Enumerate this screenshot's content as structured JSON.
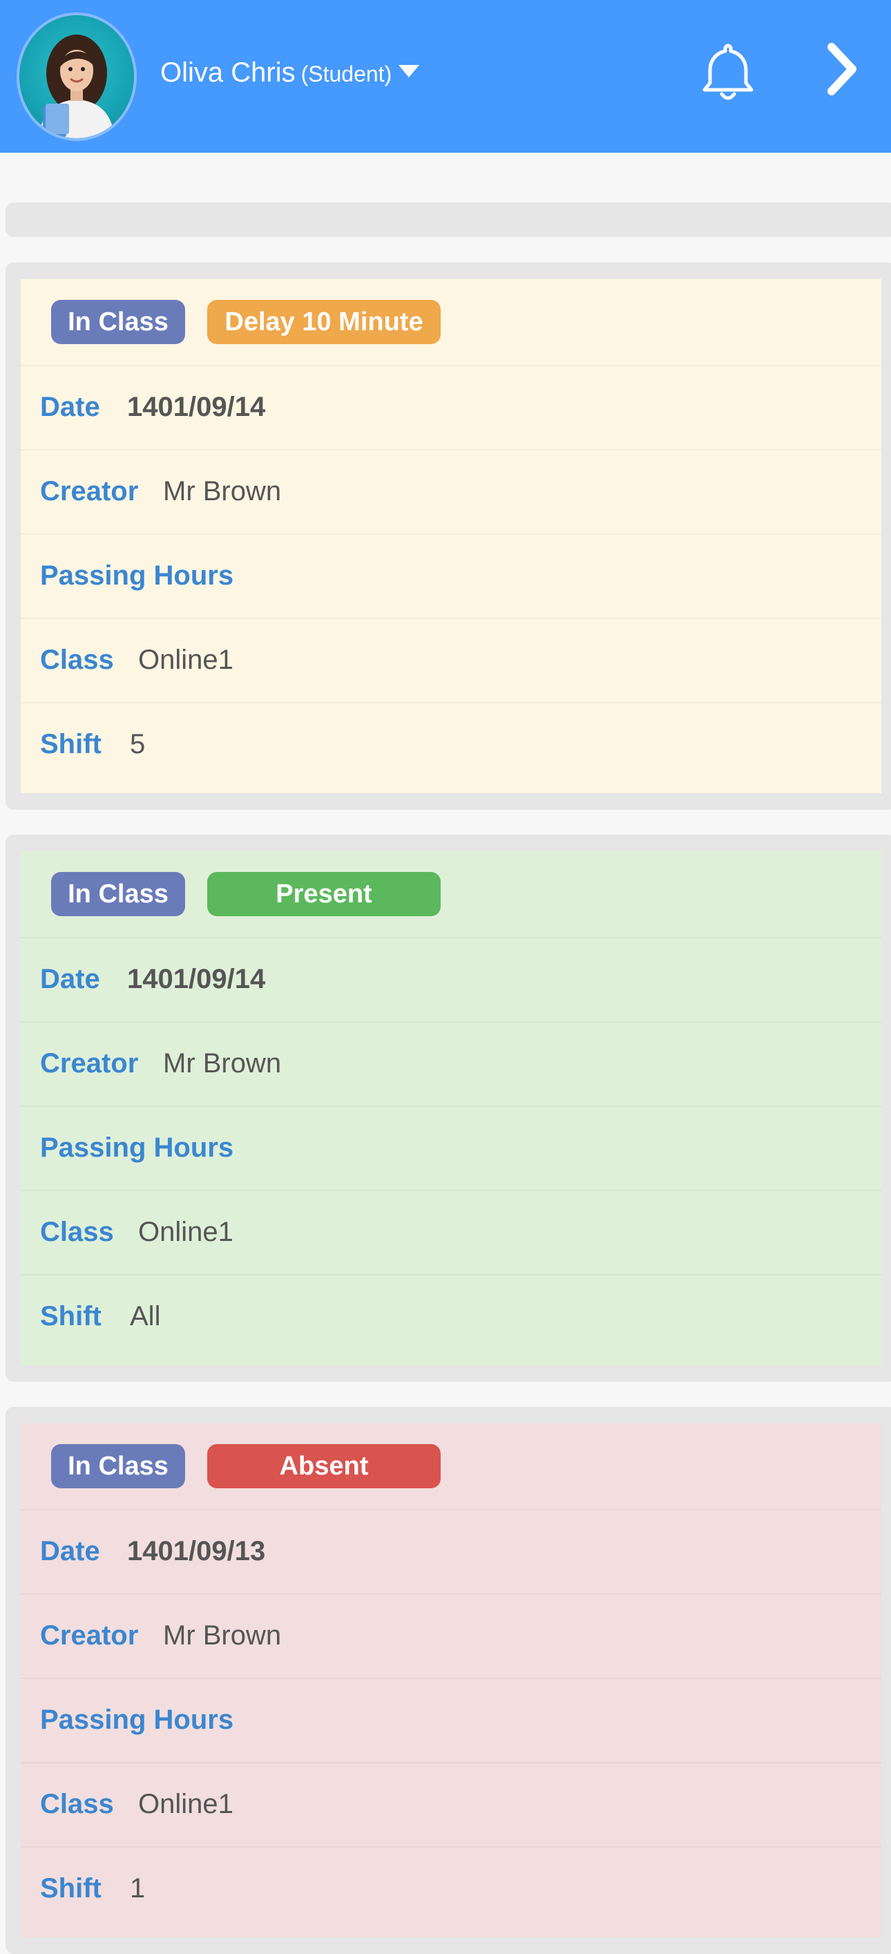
{
  "header": {
    "user_name": "Oliva Chris",
    "user_role": "(Student)",
    "avatar_icon": "student-avatar-photo",
    "caret_icon": "caret-down-icon",
    "bell_icon": "bell-icon",
    "chevron_icon": "chevron-right-icon",
    "background_color": "#4699fd"
  },
  "labels": {
    "date": "Date",
    "creator": "Creator",
    "passing_hours": "Passing Hours",
    "class": "Class",
    "shift": "Shift"
  },
  "records": [
    {
      "type_badge": "In Class",
      "status_badge": "Delay 10 Minute",
      "status_color": "#efa84a",
      "card_color": "#fdf6e3",
      "date": "1401/09/14",
      "creator": "Mr Brown",
      "passing_hours": "",
      "class": "Online1",
      "shift": "5"
    },
    {
      "type_badge": "In Class",
      "status_badge": "Present",
      "status_color": "#5cb85c",
      "card_color": "#dff0d8",
      "date": "1401/09/14",
      "creator": "Mr Brown",
      "passing_hours": "",
      "class": "Online1",
      "shift": "All"
    },
    {
      "type_badge": "In Class",
      "status_badge": "Absent",
      "status_color": "#d9534f",
      "card_color": "#f2dede",
      "date": "1401/09/13",
      "creator": "Mr Brown",
      "passing_hours": "",
      "class": "Online1",
      "shift": "1"
    }
  ]
}
